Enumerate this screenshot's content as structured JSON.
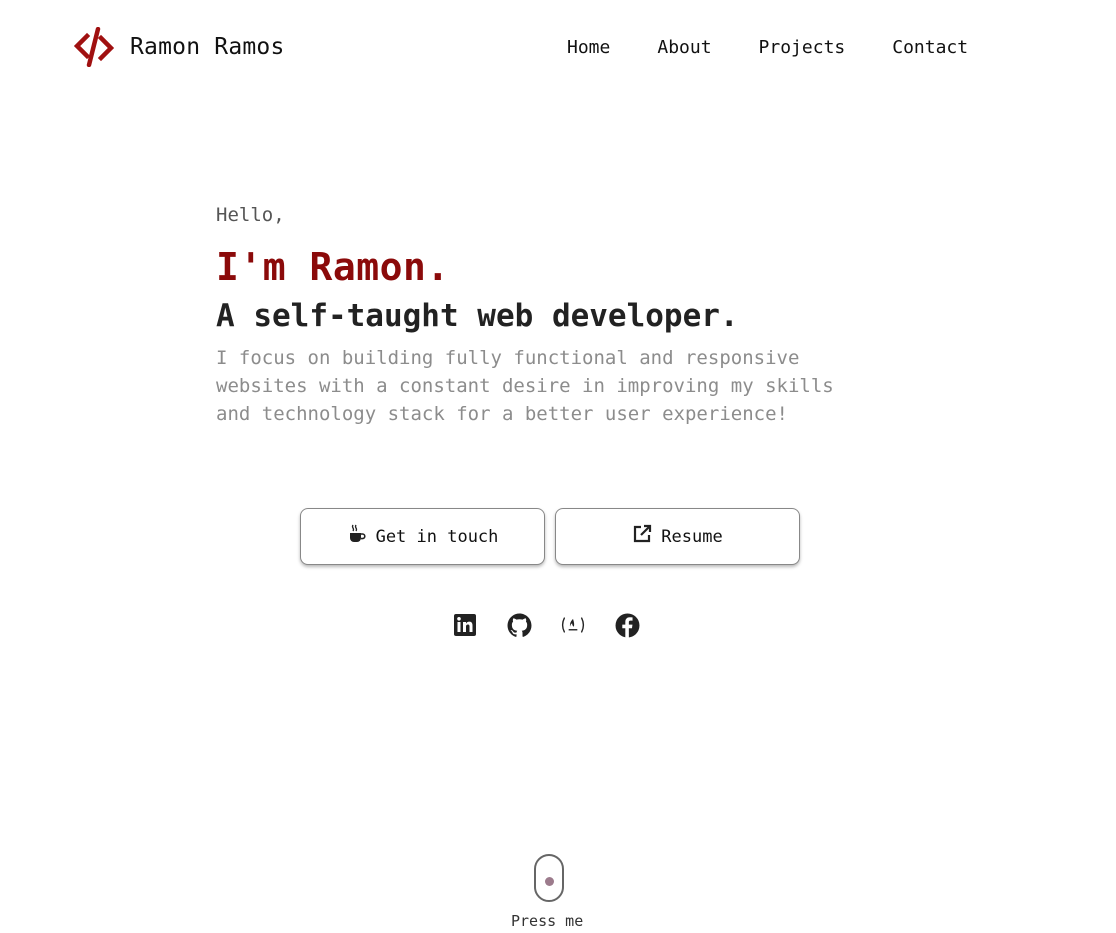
{
  "brand": {
    "name": "Ramon Ramos",
    "icon": "code-slash-icon",
    "color": "#a01010"
  },
  "nav": {
    "items": [
      "Home",
      "About",
      "Projects",
      "Contact"
    ]
  },
  "hero": {
    "greeting": "Hello,",
    "name": "I'm Ramon.",
    "tagline": "A self-taught web developer.",
    "description": "I focus on building fully functional and responsive websites with a constant desire in improving my skills and technology stack for a better user experience!"
  },
  "buttons": {
    "contact": {
      "label": "Get in touch",
      "icon": "coffee-cup-icon"
    },
    "resume": {
      "label": "Resume",
      "icon": "external-link-icon"
    }
  },
  "socials": [
    "linkedin-icon",
    "github-icon",
    "freecodecamp-icon",
    "facebook-icon"
  ],
  "scroll": {
    "label": "Press me"
  },
  "colors": {
    "accent": "#8b0a0a",
    "muted": "#8c8c8c",
    "text": "#222222"
  }
}
